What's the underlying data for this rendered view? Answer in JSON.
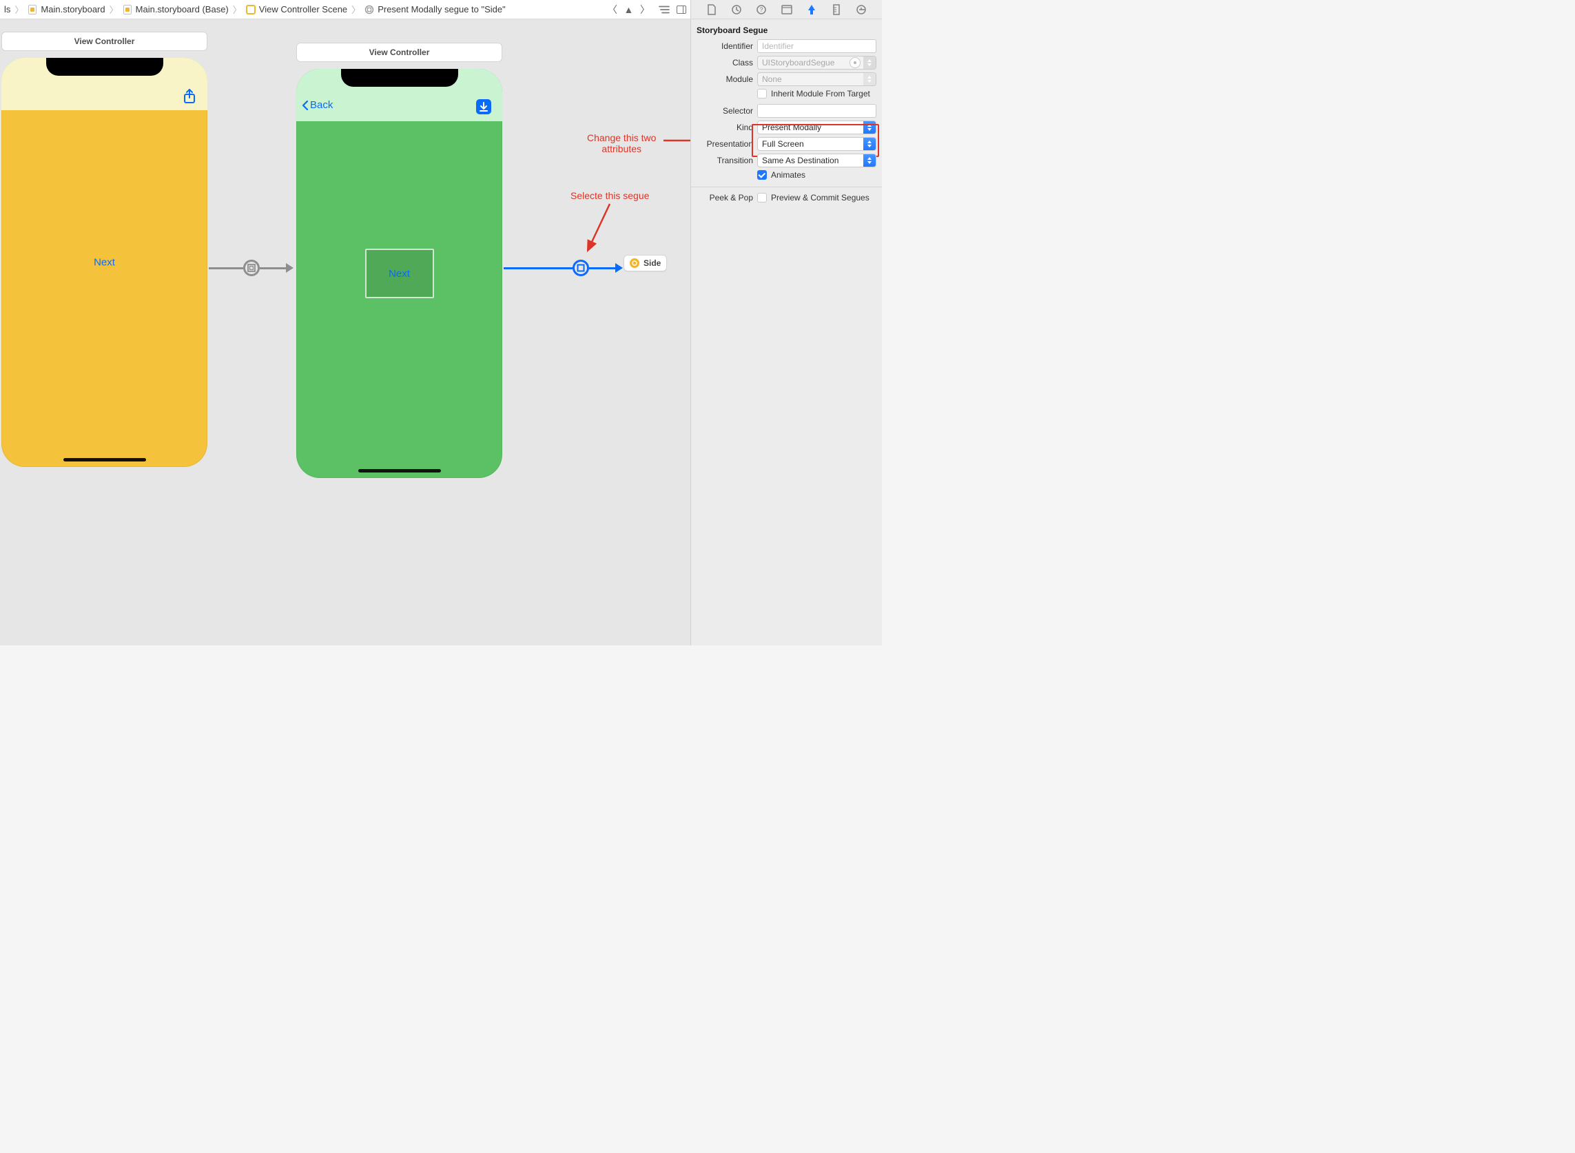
{
  "jumpbar": {
    "seg0": "ls",
    "seg1": "Main.storyboard",
    "seg2": "Main.storyboard (Base)",
    "seg3": "View Controller Scene",
    "seg4": "Present Modally segue to \"Side\""
  },
  "canvas": {
    "vc_left_title": "View Controller",
    "vc_right_title": "View Controller",
    "left_button": "Next",
    "right_back": "Back",
    "right_button": "Next",
    "side_chip": "Side"
  },
  "annotations": {
    "attrs_line1": "Change this two",
    "attrs_line2": "attributes",
    "segue": "Selecte this segue"
  },
  "inspector": {
    "title": "Storyboard Segue",
    "identifier_label": "Identifier",
    "identifier_placeholder": "Identifier",
    "class_label": "Class",
    "class_value": "UIStoryboardSegue",
    "module_label": "Module",
    "module_value": "None",
    "inherit_label": "Inherit Module From Target",
    "selector_label": "Selector",
    "kind_label": "Kind",
    "kind_value": "Present Modally",
    "presentation_label": "Presentation",
    "presentation_value": "Full Screen",
    "transition_label": "Transition",
    "transition_value": "Same As Destination",
    "animates_label": "Animates",
    "peek_pop_label": "Peek & Pop",
    "peek_pop_value": "Preview & Commit Segues"
  }
}
